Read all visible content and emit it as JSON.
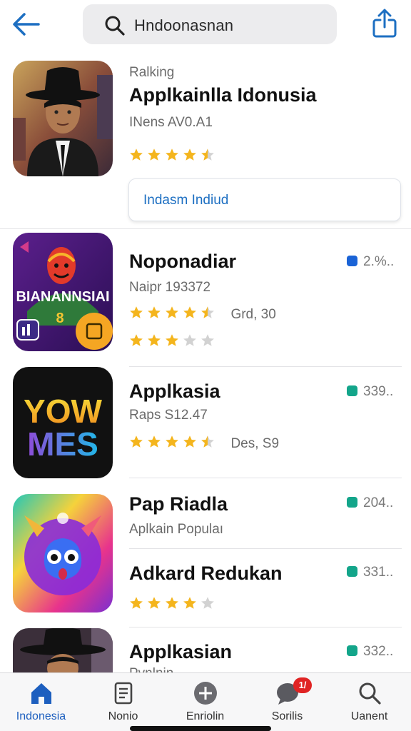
{
  "header": {
    "back_icon": "back-arrow-icon",
    "search_text": "Hndoonasnan",
    "search_icon": "search-icon",
    "share_icon": "share-icon"
  },
  "featured": {
    "subtitle": "Ralking",
    "title": "Applkainlla Idonusia",
    "meta": "INens AV0.A1",
    "rating": 4.5,
    "button_label": "Indasm Indiud"
  },
  "apps": [
    {
      "title": "Noponadiar",
      "meta": "Naipr 193372",
      "rating": 4.5,
      "rating_note": "Grd, 30",
      "rating2": 3,
      "badge": "2.%..",
      "badge_color": "#1a63d6",
      "icon_text": "BIANANNSIAI"
    },
    {
      "title": "Applkasia",
      "meta": "Raps S12.47",
      "rating": 4.5,
      "rating_note": "Des, S9",
      "badge": "339..",
      "badge_color": "#13a58a",
      "icon_line1": "YOW",
      "icon_line2": "MES"
    },
    {
      "title": "Pap Riadla",
      "meta": "Aplkain Populaı",
      "badge": "204..",
      "badge_color": "#13a58a"
    },
    {
      "title": "Adkard Redukan",
      "rating": 4,
      "badge": "331..",
      "badge_color": "#13a58a"
    },
    {
      "title": "Applkasian",
      "meta": "Pvnlnin",
      "badge": "332..",
      "badge_color": "#13a58a"
    }
  ],
  "tabs": [
    {
      "label": "Indonesia",
      "icon": "home-icon",
      "active": true
    },
    {
      "label": "Nonio",
      "icon": "document-icon"
    },
    {
      "label": "Enriolin",
      "icon": "plus-circle-icon"
    },
    {
      "label": "Sorilis",
      "icon": "chat-icon",
      "badge": "1/"
    },
    {
      "label": "Uanent",
      "icon": "search-icon"
    }
  ],
  "colors": {
    "accent": "#1d6fc2",
    "star": "#f4b51d",
    "star_empty": "#d2d2d2",
    "notif": "#e02424"
  }
}
